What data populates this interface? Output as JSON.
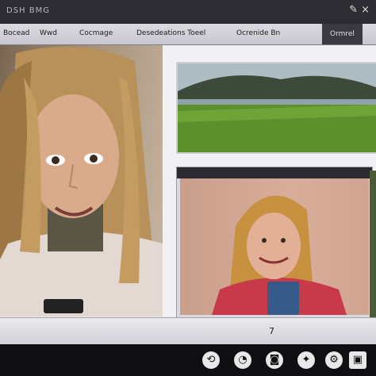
{
  "window": {
    "title": "DSH BMG",
    "controls": "✎ ×"
  },
  "menu": [
    {
      "label": "Bocead"
    },
    {
      "label": "Wwd"
    },
    {
      "label": "Cocmage"
    },
    {
      "label": "Desedeations Toeel"
    },
    {
      "label": "Ocrenide Bn"
    },
    {
      "label": "Ormrel"
    }
  ],
  "status": {
    "text": "7"
  },
  "taskbar": {
    "icons": [
      "back-icon",
      "chat-icon",
      "camera-icon",
      "settings-icon",
      "gear-icon",
      "app-icon"
    ]
  },
  "colors": {
    "titlebar": "#2e2c33",
    "taskbar": "#0f0f12",
    "grass": "#5d8f2c"
  }
}
